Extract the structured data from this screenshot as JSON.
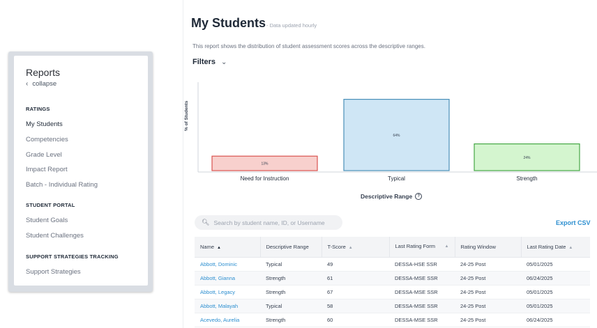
{
  "sidebar": {
    "title": "Reports",
    "collapse_label": "collapse",
    "sections": [
      {
        "heading": "RATINGS",
        "items": [
          "My Students",
          "Competencies",
          "Grade Level",
          "Impact Report",
          "Batch - Individual Rating"
        ]
      },
      {
        "heading": "STUDENT PORTAL",
        "items": [
          "Student Goals",
          "Student Challenges"
        ]
      },
      {
        "heading": "SUPPORT STRATEGIES TRACKING",
        "items": [
          "Support Strategies"
        ]
      }
    ],
    "active_item": "My Students"
  },
  "header": {
    "title": "My Students",
    "subtitle": "- Data updated hourly",
    "description": "This report shows the distribution of student assessment scores across the descriptive ranges.",
    "filters_label": "Filters"
  },
  "chart_data": {
    "type": "bar",
    "categories": [
      "Need for Instruction",
      "Typical",
      "Strength"
    ],
    "values": [
      13,
      64,
      24
    ],
    "data_labels": [
      "13%",
      "64%",
      "24%"
    ],
    "xlabel": "Descriptive Range",
    "ylabel": "% of Students",
    "ylim": [
      0,
      75
    ],
    "colors": {
      "fills": [
        "#f8d0cd",
        "#cfe6f5",
        "#d4f5cf"
      ],
      "strokes": [
        "#d9534f",
        "#4a90b8",
        "#45a745"
      ]
    }
  },
  "search": {
    "placeholder": "Search by student name, ID, or Username"
  },
  "export_label": "Export CSV",
  "table": {
    "headers": [
      "Name",
      "Descriptive Range",
      "T-Score",
      "Last Rating Form",
      "Rating Window",
      "Last Rating Date"
    ],
    "rows": [
      [
        "Abbott, Dominic",
        "Typical",
        "49",
        "DESSA-HSE SSR",
        "24-25 Post",
        "05/01/2025"
      ],
      [
        "Abbott, Gianna",
        "Strength",
        "61",
        "DESSA-MSE SSR",
        "24-25 Post",
        "06/24/2025"
      ],
      [
        "Abbott, Legacy",
        "Strength",
        "67",
        "DESSA-MSE SSR",
        "24-25 Post",
        "05/01/2025"
      ],
      [
        "Abbott, Malayah",
        "Typical",
        "58",
        "DESSA-MSE SSR",
        "24-25 Post",
        "05/01/2025"
      ],
      [
        "Acevedo, Aurelia",
        "Strength",
        "60",
        "DESSA-MSE SSR",
        "24-25 Post",
        "06/24/2025"
      ]
    ]
  }
}
